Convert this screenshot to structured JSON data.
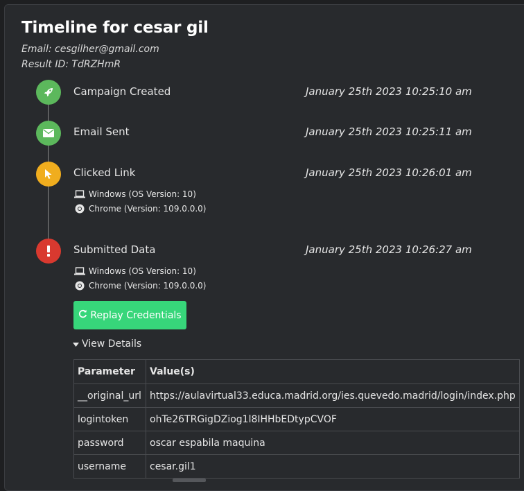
{
  "title": "Timeline for cesar gil",
  "email_line": "Email: cesgilher@gmail.com",
  "result_line": "Result ID: TdRZHmR",
  "events": [
    {
      "label": "Campaign Created",
      "time": "January 25th 2023 10:25:10 am",
      "icon": "rocket-icon",
      "color": "#5cb85c"
    },
    {
      "label": "Email Sent",
      "time": "January 25th 2023 10:25:11 am",
      "icon": "envelope-icon",
      "color": "#5cb85c"
    },
    {
      "label": "Clicked Link",
      "time": "January 25th 2023 10:26:01 am",
      "icon": "cursor-icon",
      "color": "#f0ad1e",
      "os": "Windows (OS Version: 10)",
      "browser": "Chrome (Version: 109.0.0.0)"
    },
    {
      "label": "Submitted Data",
      "time": "January 25th 2023 10:26:27 am",
      "icon": "exclamation-icon",
      "color": "#d9392f",
      "os": "Windows (OS Version: 10)",
      "browser": "Chrome (Version: 109.0.0.0)"
    }
  ],
  "replay_button": "Replay Credentials",
  "view_details": "View Details",
  "table": {
    "headers": [
      "Parameter",
      "Value(s)"
    ],
    "rows": [
      [
        "__original_url",
        "https://aulavirtual33.educa.madrid.org/ies.quevedo.madrid/login/index.php"
      ],
      [
        "logintoken",
        "ohTe26TRGigDZiog1l8IHHbEDtypCVOF"
      ],
      [
        "password",
        "oscar espabila maquina"
      ],
      [
        "username",
        "cesar.gil1"
      ]
    ]
  },
  "colors": {
    "accent_green": "#37d67a",
    "background": "#282a2d"
  }
}
